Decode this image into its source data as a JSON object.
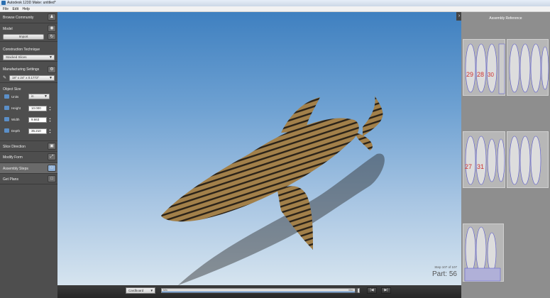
{
  "window": {
    "title": "Autodesk 123D Make: untitled*"
  },
  "menu": [
    "File",
    "Edit",
    "Help"
  ],
  "left_panel": {
    "browse_community": "Browse Community",
    "model": {
      "label": "Model",
      "import_label": "Import"
    },
    "construction_technique": {
      "label": "Construction Technique",
      "selected": "Stacked Slices"
    },
    "manufacturing_settings": {
      "label": "Manufacturing Settings",
      "selected": "18\" x 24\" x 0.1772\""
    },
    "object_size": {
      "label": "Object Size",
      "units_label": "Units",
      "units_value": "in",
      "height_label": "Height",
      "height_value": "10.000",
      "width_label": "Width",
      "width_value": "9.663",
      "depth_label": "Depth",
      "depth_value": "35.210"
    },
    "slice_direction": "Slice Direction",
    "modify_form": "Modify Form",
    "assembly_steps": "Assembly Steps",
    "get_plans": "Get Plans"
  },
  "viewport": {
    "step_text": "Step 107 of 107",
    "part_text": "Part: 56"
  },
  "bottom_bar": {
    "material": "Cardboard",
    "slider_min": "Min",
    "slider_max": "Max",
    "slider_progress": 1.0
  },
  "right_panel": {
    "title": "Assembly Reference",
    "sheet_numbers": [
      "29",
      "28",
      "30",
      "27",
      "31"
    ]
  },
  "colors": {
    "left_panel_bg": "#4e4e4e",
    "viewport_sky_top": "#3f80c0",
    "viewport_sky_bottom": "#d6e4ef",
    "cardboard": "#a2804a",
    "right_panel_bg": "#8e8e8e",
    "sheet_part_outline": "#5555cc",
    "sheet_number": "#cc3333"
  }
}
